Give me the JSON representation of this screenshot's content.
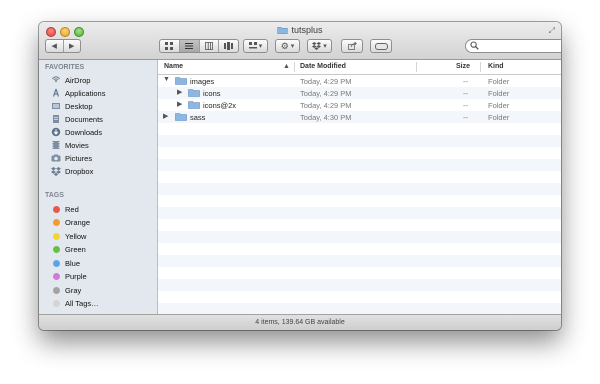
{
  "window": {
    "title": "tutsplus"
  },
  "sidebar": {
    "favorites_header": "FAVORITES",
    "favorites": [
      {
        "label": "AirDrop",
        "icon": "airdrop-icon"
      },
      {
        "label": "Applications",
        "icon": "applications-icon"
      },
      {
        "label": "Desktop",
        "icon": "desktop-icon"
      },
      {
        "label": "Documents",
        "icon": "documents-icon"
      },
      {
        "label": "Downloads",
        "icon": "downloads-icon"
      },
      {
        "label": "Movies",
        "icon": "movies-icon"
      },
      {
        "label": "Pictures",
        "icon": "pictures-icon"
      },
      {
        "label": "Dropbox",
        "icon": "dropbox-icon"
      }
    ],
    "tags_header": "TAGS",
    "tags": [
      {
        "label": "Red",
        "color": "#e9574b"
      },
      {
        "label": "Orange",
        "color": "#f49a35"
      },
      {
        "label": "Yellow",
        "color": "#eed634"
      },
      {
        "label": "Green",
        "color": "#66c044"
      },
      {
        "label": "Blue",
        "color": "#5aa5ea"
      },
      {
        "label": "Purple",
        "color": "#d07ad8"
      },
      {
        "label": "Gray",
        "color": "#a3a3a3"
      },
      {
        "label": "All Tags…",
        "color": "#d4d4d4"
      }
    ]
  },
  "columns": {
    "name": "Name",
    "date": "Date Modified",
    "size": "Size",
    "kind": "Kind"
  },
  "files": [
    {
      "name": "images",
      "date": "Today, 4:29 PM",
      "size": "--",
      "kind": "Folder",
      "expanded": true
    },
    {
      "name": "icons",
      "date": "Today, 4:29 PM",
      "size": "--",
      "kind": "Folder",
      "expanded": false
    },
    {
      "name": "icons@2x",
      "date": "Today, 4:29 PM",
      "size": "--",
      "kind": "Folder",
      "expanded": false
    },
    {
      "name": "sass",
      "date": "Today, 4:30 PM",
      "size": "--",
      "kind": "Folder",
      "expanded": false
    }
  ],
  "status": {
    "text": "4 items, 139.64 GB available"
  },
  "colors": {
    "folder": "#8db6e1",
    "sidebar_bg": "#e3e8ee",
    "row_alt": "#f3f6fa"
  }
}
